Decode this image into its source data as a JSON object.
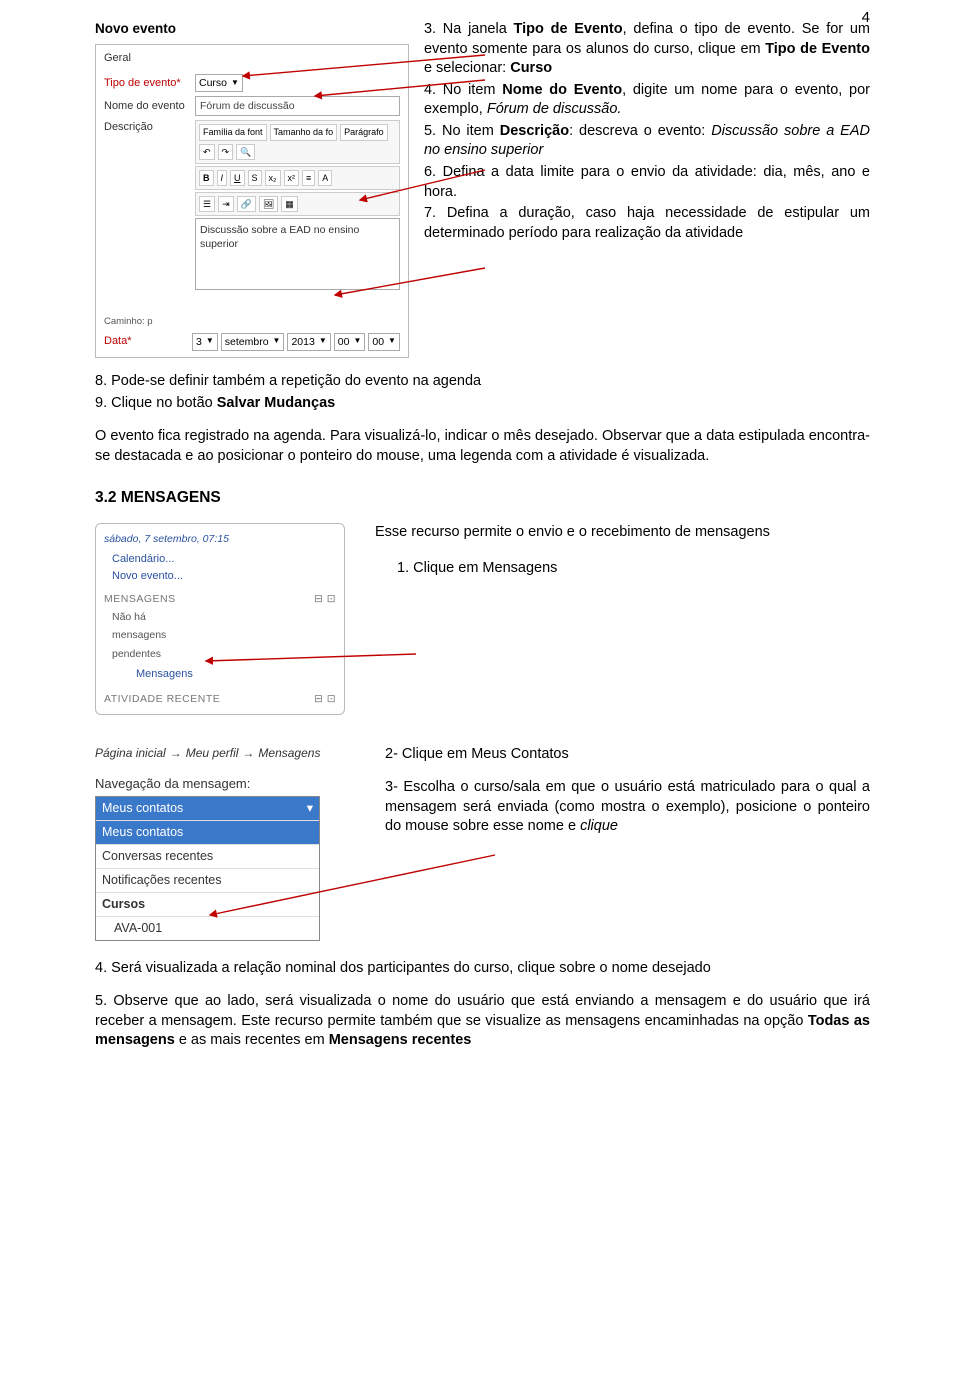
{
  "page_number": "4",
  "figure1": {
    "title": "Novo evento",
    "geral_label": "Geral",
    "tipo_label": "Tipo de evento*",
    "tipo_value": "Curso",
    "nome_label": "Nome do evento",
    "nome_value": "Fórum de discussão",
    "desc_label": "Descrição",
    "tool_font": "Família da font",
    "tool_size": "Tamanho da fo",
    "tool_para": "Parágrafo",
    "editor_text": "Discussão sobre a EAD no ensino superior",
    "path": "Caminho: p",
    "data_label": "Data*",
    "day": "3",
    "month": "setembro",
    "year": "2013",
    "hour": "00",
    "min": "00"
  },
  "steps": {
    "s3a": "3. Na janela ",
    "s3b": "Tipo de Evento",
    "s3c": ", defina o tipo de evento. Se for um evento somente para os alunos do curso, clique em ",
    "s3d": "Tipo de Evento",
    "s3e": " e selecionar: ",
    "s3f": "Curso",
    "s4a": "4. No item ",
    "s4b": "Nome do Evento",
    "s4c": ", digite um nome para o evento, por exemplo, ",
    "s4d": "Fórum de discussão.",
    "s5a": "5. No item ",
    "s5b": "Descrição",
    "s5c": ": descreva o evento: ",
    "s5d": "Discussão sobre a EAD no ensino superior",
    "s6": "6. Defina a data limite para o envio da atividade: dia, mês, ano e hora.",
    "s7": "7. Defina a duração, caso haja necessidade de estipular um determinado período para realização da atividade",
    "s8": "8. Pode-se definir também a repetição do evento na agenda",
    "s9a": "9. Clique no botão ",
    "s9b": "Salvar Mudanças"
  },
  "para1": "O evento fica registrado na agenda. Para visualizá-lo, indicar o mês desejado. Observar que a data estipulada encontra-se destacada e ao posicionar o ponteiro do mouse, uma legenda com a atividade é visualizada.",
  "section_title": "3.2 MENSAGENS",
  "figure2": {
    "date": "sábado, 7 setembro, 07:15",
    "link1": "Calendário...",
    "link2": "Novo evento...",
    "hdr1": "MENSAGENS",
    "icons": "⊟ ⊡",
    "none1": "Não há",
    "none2": "mensagens",
    "none3": "pendentes",
    "msgs_link": "Mensagens",
    "hdr2": "ATIVIDADE RECENTE"
  },
  "mid_text": {
    "t1": "Esse recurso permite o envio e o recebimento de mensagens",
    "t2": "1. Clique em Mensagens"
  },
  "figure3": {
    "bc1": "Página inicial",
    "bc2": "Meu perfil",
    "bc3": "Mensagens",
    "nav_label": "Navegação da mensagem:",
    "sel": "Meus contatos",
    "opt1": "Meus contatos",
    "opt2": "Conversas recentes",
    "opt3": "Notificações recentes",
    "opt4": "Cursos",
    "opt5": "  AVA-001"
  },
  "bot_text": {
    "t1": "2- Clique em Meus Contatos",
    "t2a": "3- Escolha o curso/sala em que o usuário está matriculado para o qual a mensagem será enviada (como mostra o exemplo), posicione o ponteiro do mouse sobre esse nome e ",
    "t2b": "clique"
  },
  "final": {
    "p1": "4. Será visualizada a relação nominal dos participantes do curso, clique sobre o nome desejado",
    "p2a": "5. Observe que ao lado, será visualizada o nome do usuário que está enviando a mensagem e do usuário que irá receber a mensagem. Este recurso permite também que se visualize as mensagens encaminhadas na opção ",
    "p2b": "Todas as mensagens",
    "p2c": " e as mais recentes em ",
    "p2d": "Mensagens recentes"
  }
}
